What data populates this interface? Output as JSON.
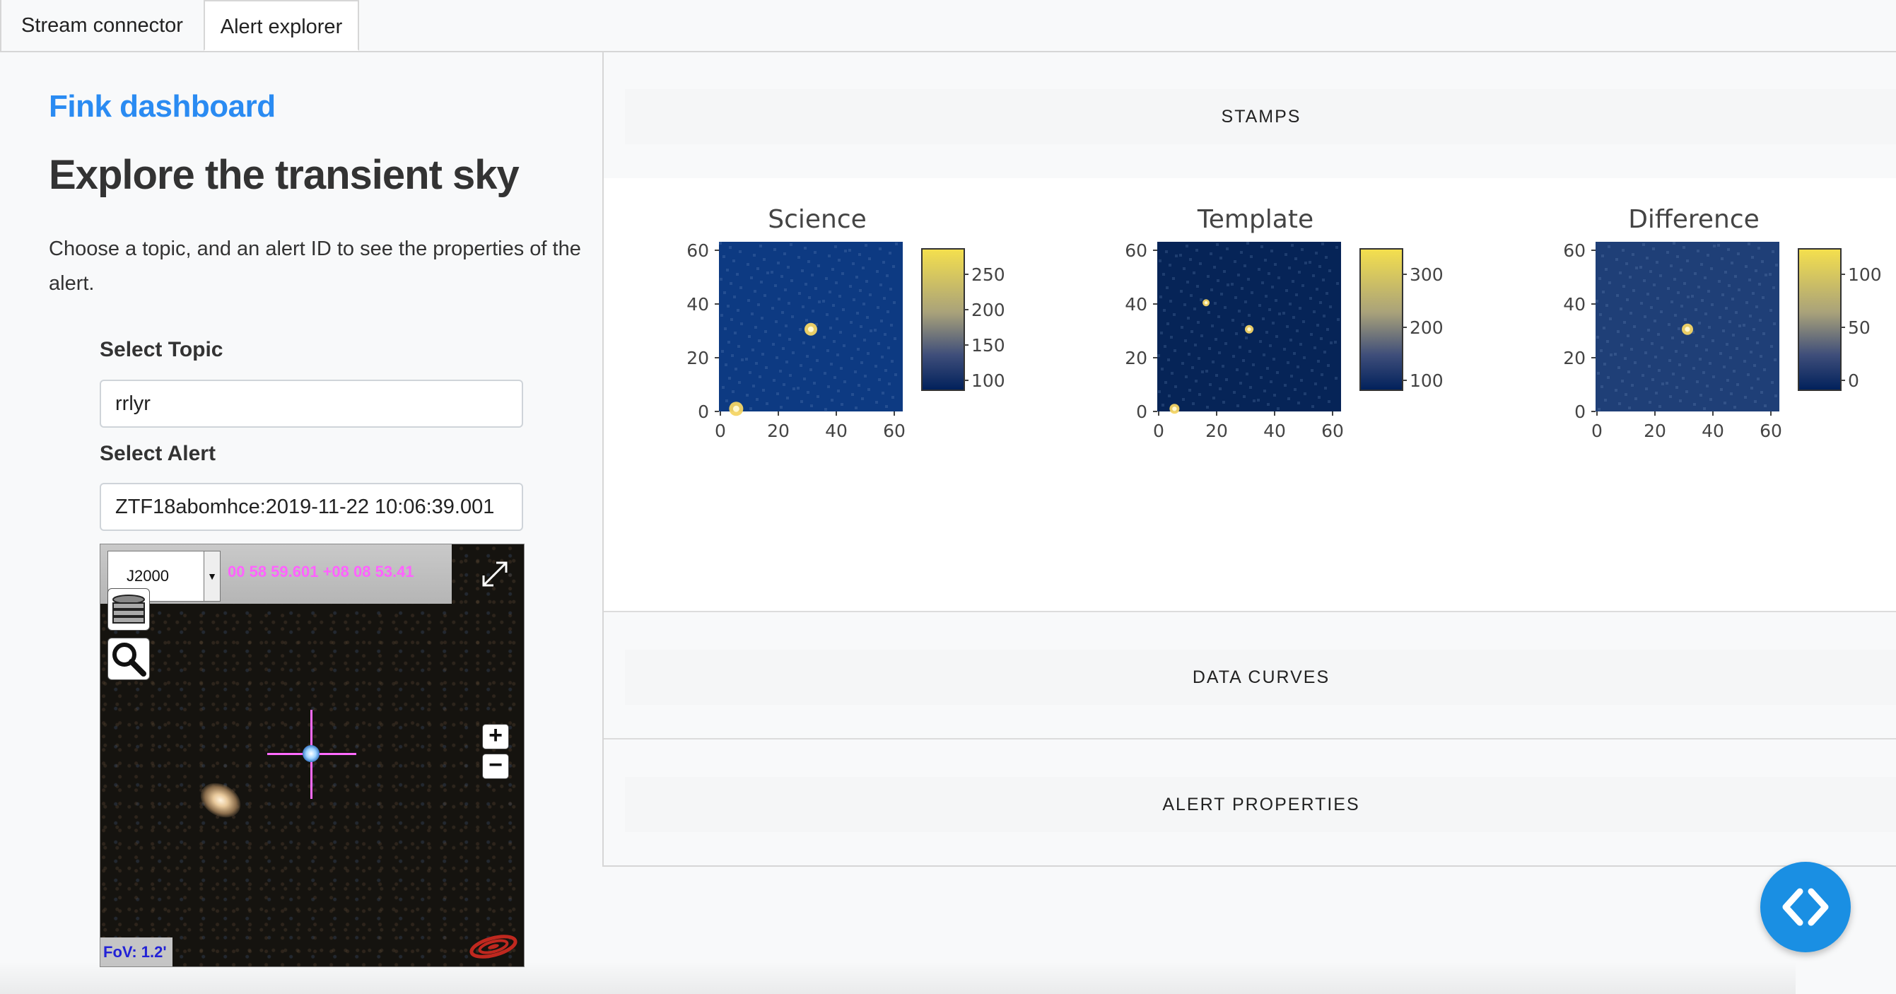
{
  "tabs": [
    {
      "label": "Stream connector",
      "active": false
    },
    {
      "label": "Alert explorer",
      "active": true
    }
  ],
  "sidebar": {
    "brand": "Fink dashboard",
    "headline": "Explore the transient sky",
    "intro": "Choose a topic, and an alert ID to see the properties of the alert.",
    "topic_label": "Select Topic",
    "topic_value": "rrlyr",
    "alert_label": "Select Alert",
    "alert_value": "ZTF18abomhce:2019-11-22 10:06:39.001"
  },
  "aladin": {
    "frame": "J2000",
    "coordinates": "00 58 59.601 +08 08 53.41",
    "fov": "FoV: 1.2'",
    "icons": [
      "layers-icon",
      "search-icon",
      "expand-icon",
      "zoom-in-icon",
      "zoom-out-icon",
      "aladin-logo-icon"
    ]
  },
  "main": {
    "sections": [
      {
        "label": "STAMPS",
        "expanded": true
      },
      {
        "label": "DATA CURVES",
        "expanded": false
      },
      {
        "label": "ALERT PROPERTIES",
        "expanded": false
      }
    ],
    "stamps": [
      {
        "title": "Science",
        "colorbar_ticks": [
          "250",
          "200",
          "150",
          "100"
        ],
        "axis_ticks_y": [
          "60",
          "40",
          "20",
          "0"
        ],
        "axis_ticks_x": [
          "0",
          "20",
          "40",
          "60"
        ],
        "image_color": "#0d3a82"
      },
      {
        "title": "Template",
        "colorbar_ticks": [
          "300",
          "200",
          "100"
        ],
        "axis_ticks_y": [
          "60",
          "40",
          "20",
          "0"
        ],
        "axis_ticks_x": [
          "0",
          "20",
          "40",
          "60"
        ],
        "image_color": "#062457"
      },
      {
        "title": "Difference",
        "colorbar_ticks": [
          "100",
          "50",
          "0"
        ],
        "axis_ticks_y": [
          "60",
          "40",
          "20",
          "0"
        ],
        "axis_ticks_x": [
          "0",
          "20",
          "40",
          "60"
        ],
        "image_color": "#1f3f77"
      }
    ]
  },
  "colors": {
    "brand": "#2a8bf2",
    "fab": "#1a8fe3",
    "reticle": "#ff6bff"
  }
}
